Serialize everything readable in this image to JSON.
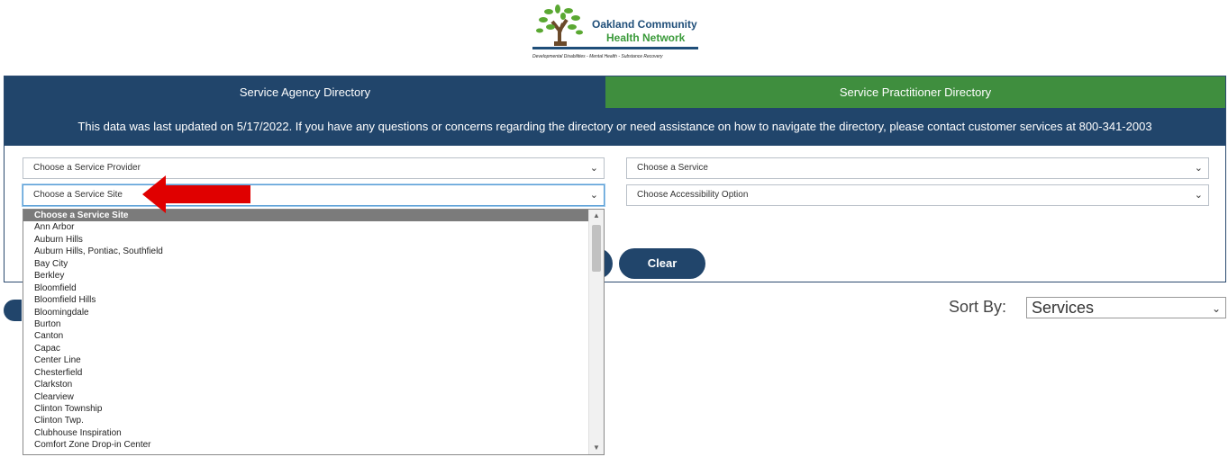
{
  "logo": {
    "line1": "Oakland Community",
    "line2": "Health Network",
    "tagline": "Developmental Disabilities - Mental Health - Substance Recovery"
  },
  "tabs": {
    "agency": "Service Agency Directory",
    "practitioner": "Service Practitioner Directory"
  },
  "notice": "This data was last updated on 5/17/2022. If you have any questions or concerns regarding the directory or need assistance on how to navigate the directory, please contact customer services at 800-341-2003",
  "filters": {
    "provider": "Choose a Service Provider",
    "site": "Choose a Service Site",
    "service": "Choose a Service",
    "accessibility": "Choose Accessibility Option"
  },
  "buttons": {
    "clear": "Clear"
  },
  "sort": {
    "label": "Sort By:",
    "value": "Services"
  },
  "dropdown_items": [
    "Choose a Service Site",
    "Ann Arbor",
    "Auburn Hills",
    "Auburn Hills, Pontiac, Southfield",
    "Bay City",
    "Berkley",
    "Bloomfield",
    "Bloomfield Hills",
    "Bloomingdale",
    "Burton",
    "Canton",
    "Capac",
    "Center Line",
    "Chesterfield",
    "Clarkston",
    "Clearview",
    "Clinton Township",
    "Clinton Twp.",
    "Clubhouse Inspiration",
    "Comfort Zone Drop-in Center"
  ],
  "icons": {
    "chevron": "chevron-down-icon",
    "arrow": "red-arrow-icon"
  },
  "colors": {
    "navy": "#21456b",
    "green": "#3f8e3e",
    "selected_item": "#7b7b7b",
    "arrow": "#e00000"
  }
}
